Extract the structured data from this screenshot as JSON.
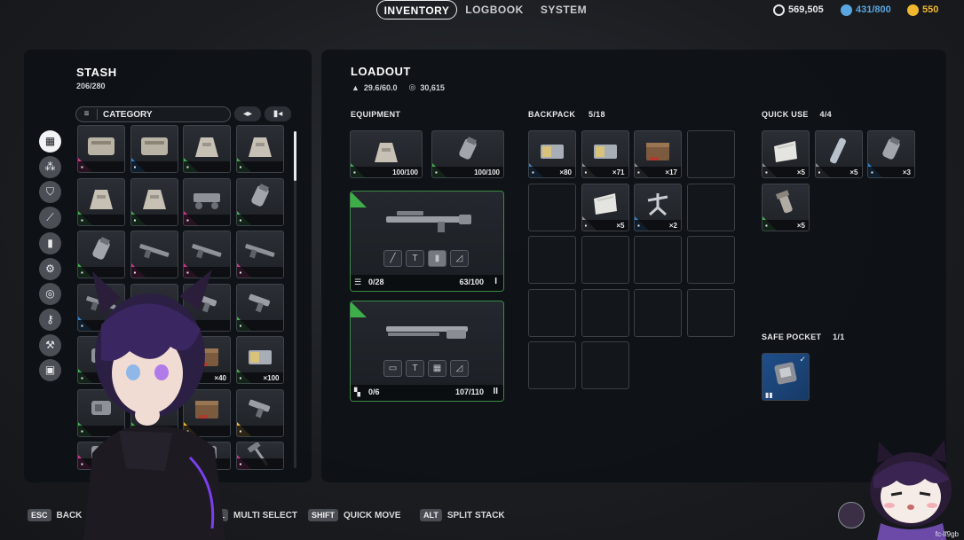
{
  "nav": {
    "tabs": [
      {
        "label": "INVENTORY",
        "active": true
      },
      {
        "label": "LOGBOOK",
        "active": false
      },
      {
        "label": "SYSTEM",
        "active": false
      }
    ],
    "currencies": [
      {
        "icon": "coins-icon",
        "value": "569,505",
        "color": "#e6e8ea"
      },
      {
        "icon": "token-icon",
        "value": "431/800",
        "color": "#5aa7e0"
      },
      {
        "icon": "gold-icon",
        "value": "550",
        "color": "#f1b72e"
      }
    ]
  },
  "stash": {
    "title": "STASH",
    "capacity": "206/280",
    "filter_label": "CATEGORY",
    "categories": [
      "grid-icon",
      "ammo-icon",
      "shield-icon",
      "knife-icon",
      "magazine-icon",
      "gear-icon",
      "ring-icon",
      "key-icon",
      "wrench-icon",
      "box-icon"
    ],
    "rows": [
      [
        {
          "rarity": "#d0368c",
          "qty": "",
          "art": "crate"
        },
        {
          "rarity": "#2d84d0",
          "qty": "",
          "art": "crate"
        },
        {
          "rarity": "#3fae4a",
          "qty": "",
          "art": "mound"
        },
        {
          "rarity": "#3fae4a",
          "qty": "",
          "art": "mound"
        }
      ],
      [
        {
          "rarity": "#3fae4a",
          "qty": "",
          "art": "mound"
        },
        {
          "rarity": "#3fae4a",
          "qty": "",
          "art": "mound"
        },
        {
          "rarity": "#d0368c",
          "qty": "",
          "art": "mech"
        },
        {
          "rarity": "#3fae4a",
          "qty": "",
          "art": "grenade"
        }
      ],
      [
        {
          "rarity": "#3fae4a",
          "qty": "",
          "art": "grenade"
        },
        {
          "rarity": "#d0368c",
          "qty": "",
          "art": "gun"
        },
        {
          "rarity": "#d0368c",
          "qty": "",
          "art": "gun"
        },
        {
          "rarity": "#d0368c",
          "qty": "",
          "art": "gun"
        }
      ],
      [
        {
          "rarity": "#2d84d0",
          "qty": "",
          "art": "gun"
        },
        {
          "rarity": "#3fae4a",
          "qty": "",
          "art": "gun"
        },
        {
          "rarity": "#3fae4a",
          "qty": "",
          "art": "pistol"
        },
        {
          "rarity": "#3fae4a",
          "qty": "",
          "art": "pistol"
        }
      ],
      [
        {
          "rarity": "#3fae4a",
          "qty": "",
          "art": "part"
        },
        {
          "rarity": "#3fae4a",
          "qty": "",
          "art": "part"
        },
        {
          "rarity": "#d0368c",
          "qty": "×40",
          "art": "box"
        },
        {
          "rarity": "#3fae4a",
          "qty": "×100",
          "art": "ammo"
        }
      ],
      [
        {
          "rarity": "#3fae4a",
          "qty": "",
          "art": "part"
        },
        {
          "rarity": "#3fae4a",
          "qty": "",
          "art": "part"
        },
        {
          "rarity": "#f1b72e",
          "qty": "",
          "art": "box"
        },
        {
          "rarity": "#f1b72e",
          "qty": "",
          "art": "pistol"
        }
      ],
      [
        {
          "rarity": "#d0368c",
          "qty": "",
          "art": "part"
        },
        {
          "rarity": "#3fae4a",
          "qty": "",
          "art": "part"
        },
        {
          "rarity": "#3fae4a",
          "qty": "",
          "art": "part"
        },
        {
          "rarity": "#d0368c",
          "qty": "",
          "art": "hammer"
        }
      ]
    ]
  },
  "loadout": {
    "title": "LOADOUT",
    "weight": "29.6/60.0",
    "value": "30,615",
    "equipment_label": "EQUIPMENT",
    "equipment": [
      {
        "rarity": "#3fae4a",
        "qty": "100/100",
        "art": "mound"
      },
      {
        "rarity": "#3fae4a",
        "qty": "100/100",
        "art": "grenade"
      }
    ],
    "weapons": [
      {
        "ammo": "0/28",
        "durability": "63/100",
        "tier": "I"
      },
      {
        "ammo": "0/6",
        "durability": "107/110",
        "tier": "II"
      }
    ],
    "backpack_label": "BACKPACK",
    "backpack_count": "5/18",
    "backpack_items": [
      {
        "rarity": "#2d84d0",
        "qty": "×80",
        "art": "ammo"
      },
      {
        "rarity": "#8a8f96",
        "qty": "×71",
        "art": "ammo"
      },
      {
        "rarity": "#8a8f96",
        "qty": "×17",
        "art": "box"
      },
      {
        "rarity": "#8a8f96",
        "qty": "×5",
        "art": "bandage"
      },
      {
        "rarity": "#2d84d0",
        "qty": "×2",
        "art": "turret"
      }
    ],
    "quick_use_label": "QUICK USE",
    "quick_use_count": "4/4",
    "quick_use_items": [
      {
        "rarity": "#8a8f96",
        "qty": "×5",
        "art": "bandage"
      },
      {
        "rarity": "#8a8f96",
        "qty": "×5",
        "art": "tube"
      },
      {
        "rarity": "#2d84d0",
        "qty": "×3",
        "art": "grenade"
      },
      {
        "rarity": "#3fae4a",
        "qty": "×5",
        "art": "spray"
      }
    ],
    "safe_pocket_label": "SAFE POCKET",
    "safe_pocket_count": "1/1"
  },
  "hints": [
    {
      "key": "ESC",
      "label": "BACK"
    },
    {
      "key": "CTRL",
      "label": "MULTI SELECT"
    },
    {
      "key": "SHIFT",
      "label": "QUICK MOVE"
    },
    {
      "key": "ALT",
      "label": "SPLIT STACK"
    }
  ],
  "overlay": {
    "watermark": "fc-lf9gb"
  }
}
